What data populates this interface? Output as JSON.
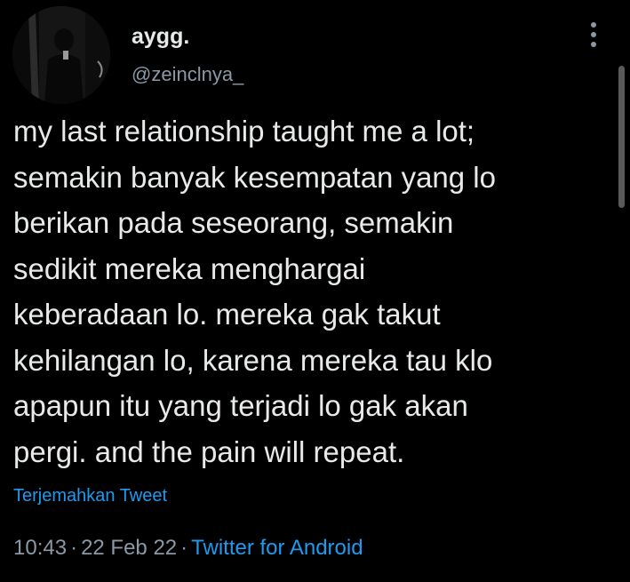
{
  "author": {
    "display_name": "aygg.",
    "handle": "@zeinclnya_",
    "avatar_icon": "profile-photo"
  },
  "tweet": {
    "lines": [
      "my last relationship taught me a lot;",
      "semakin banyak kesempatan yang lo",
      "berikan pada seseorang, semakin",
      "sedikit mereka menghargai",
      "keberadaan lo. mereka gak takut",
      "kehilangan lo, karena mereka tau klo",
      "apapun itu yang terjadi lo gak akan",
      "pergi. and the pain will repeat."
    ],
    "translate_label": "Terjemahkan Tweet"
  },
  "meta": {
    "time": "10:43",
    "separator": "·",
    "date": "22 Feb 22",
    "source": "Twitter for Android"
  },
  "icons": {
    "more": "more-vertical-icon"
  },
  "colors": {
    "background": "#000000",
    "text": "#e7e9ea",
    "secondary": "#8b98a5",
    "accent": "#1d9bf0"
  }
}
